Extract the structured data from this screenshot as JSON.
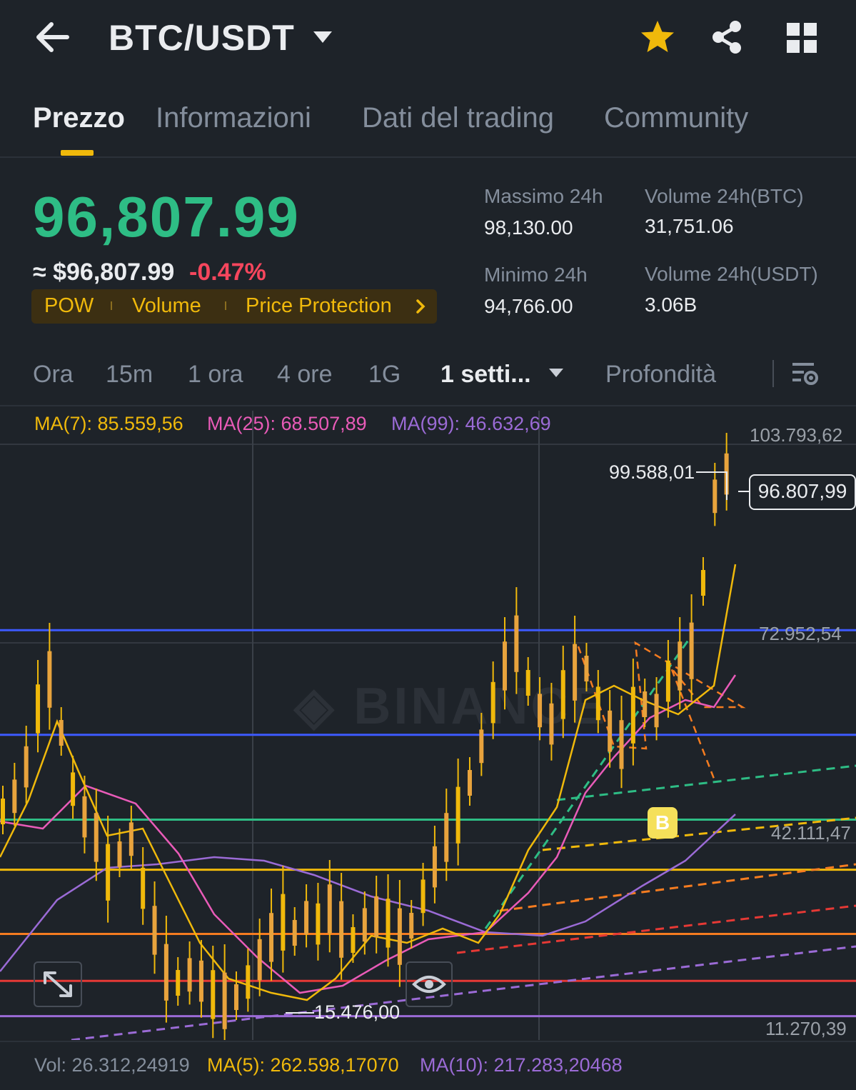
{
  "header": {
    "pair": "BTC/USDT",
    "icons": [
      "back-arrow-icon",
      "caret-down-icon",
      "star-icon",
      "share-icon",
      "grid-icon"
    ],
    "star_color": "#f0b90b"
  },
  "tabs": [
    {
      "label": "Prezzo",
      "active": true
    },
    {
      "label": "Informazioni",
      "active": false
    },
    {
      "label": "Dati del trading",
      "active": false
    },
    {
      "label": "Community",
      "active": false
    }
  ],
  "price": {
    "last": "96,807.99",
    "usd_approx": "≈ $96,807.99",
    "change": "-0.47%",
    "last_color": "#2ebd85",
    "change_color": "#f6465d"
  },
  "tags": [
    "POW",
    "Volume",
    "Price Protection"
  ],
  "stats": {
    "high_label": "Massimo 24h",
    "high_value": "98,130.00",
    "low_label": "Minimo 24h",
    "low_value": "94,766.00",
    "vol_btc_label": "Volume 24h(BTC)",
    "vol_btc_value": "31,751.06",
    "vol_usdt_label": "Volume 24h(USDT)",
    "vol_usdt_value": "3.06B"
  },
  "intervals": [
    {
      "label": "Ora",
      "active": false
    },
    {
      "label": "15m",
      "active": false
    },
    {
      "label": "1 ora",
      "active": false
    },
    {
      "label": "4 ore",
      "active": false
    },
    {
      "label": "1G",
      "active": false
    },
    {
      "label": "1 setti...",
      "active": true
    },
    {
      "label": "Profondità",
      "active": false
    }
  ],
  "chart_data": {
    "type": "candlestick",
    "watermark": "BINANCE",
    "ma": [
      {
        "name": "MA(7)",
        "value": "85.559,56",
        "color": "#f0b90b"
      },
      {
        "name": "MA(25)",
        "value": "68.507,89",
        "color": "#e95bb8"
      },
      {
        "name": "MA(99)",
        "value": "46.632,69",
        "color": "#9b6bd6"
      }
    ],
    "y_axis_labels": [
      "103.793,62",
      "72.952,54",
      "42.111,47",
      "11.270,39"
    ],
    "last_price": "96.807,99",
    "high_marker": "99.588,01",
    "low_marker": "15.476,00",
    "signal_marker": "B",
    "ylim": [
      11270.39,
      103793.62
    ],
    "horizontal_lines": [
      {
        "value": 73300,
        "color": "#3d5afe"
      },
      {
        "value": 57000,
        "color": "#3d5afe"
      },
      {
        "value": 43800,
        "color": "#2ebd85"
      },
      {
        "value": 36000,
        "color": "#f0b90b"
      },
      {
        "value": 26000,
        "color": "#f57c20"
      },
      {
        "value": 18700,
        "color": "#e53935"
      },
      {
        "value": 13200,
        "color": "#9b6bd6"
      }
    ],
    "grid": true
  },
  "volume": {
    "vol": "Vol: 26.312,24919",
    "ma5": "MA(5): 262.598,17070",
    "ma10": "MA(10): 217.283,20468"
  }
}
